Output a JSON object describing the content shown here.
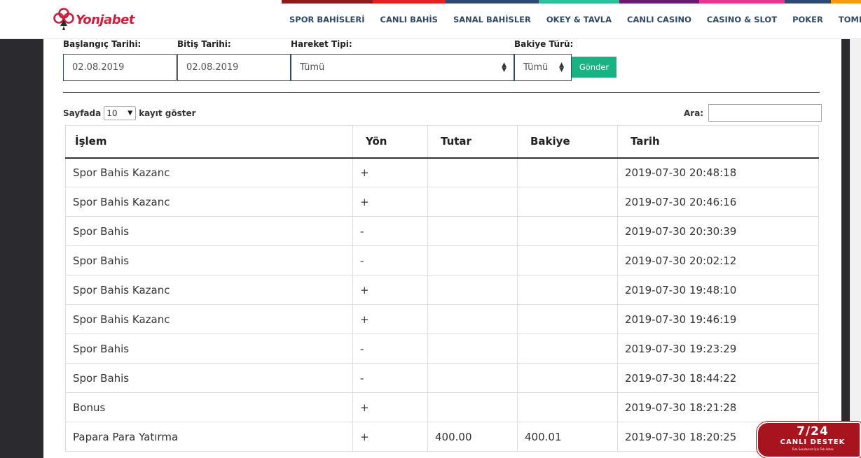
{
  "header": {
    "logo_text": "Yonjabet",
    "nav": [
      {
        "label": "SPOR BAHİSLERİ",
        "color": "#8b1c1c"
      },
      {
        "label": "CANLI BAHİS",
        "color": "#e31f1f"
      },
      {
        "label": "SANAL BAHİSLER",
        "color": "#2f4a6e"
      },
      {
        "label": "OKEY & TAVLA",
        "color": "#2fbf9b"
      },
      {
        "label": "CANLI CASINO",
        "color": "#6a1a73"
      },
      {
        "label": "CASINO & SLOT",
        "color": "#e8368f"
      },
      {
        "label": "POKER",
        "color": "#2f4a6e"
      },
      {
        "label": "TOMBALA",
        "color": "#f39c12"
      }
    ]
  },
  "filters": {
    "start_label": "Başlangıç Tarihi:",
    "start_value": "02.08.2019",
    "end_label": "Bitiş Tarihi:",
    "end_value": "02.08.2019",
    "type_label": "Hareket Tipi:",
    "type_value": "Tümü",
    "balance_label": "Bakiye Türü:",
    "balance_value": "Tümü",
    "submit_label": "Gönder"
  },
  "table_controls": {
    "length_prefix": "Sayfada",
    "length_value": "10",
    "length_suffix": "kayıt göster",
    "search_label": "Ara:"
  },
  "table": {
    "columns": [
      "İşlem",
      "Yön",
      "Tutar",
      "Bakiye",
      "Tarih"
    ],
    "rows": [
      [
        "Spor Bahis Kazanc",
        "+",
        "",
        "",
        "2019-07-30 20:48:18"
      ],
      [
        "Spor Bahis Kazanc",
        "+",
        "",
        "",
        "2019-07-30 20:46:16"
      ],
      [
        "Spor Bahis",
        "-",
        "",
        "",
        "2019-07-30 20:30:39"
      ],
      [
        "Spor Bahis",
        "-",
        "",
        "",
        "2019-07-30 20:02:12"
      ],
      [
        "Spor Bahis Kazanc",
        "+",
        "",
        "",
        "2019-07-30 19:48:10"
      ],
      [
        "Spor Bahis Kazanc",
        "+",
        "",
        "",
        "2019-07-30 19:46:19"
      ],
      [
        "Spor Bahis",
        "-",
        "",
        "",
        "2019-07-30 19:23:29"
      ],
      [
        "Spor Bahis",
        "-",
        "",
        "",
        "2019-07-30 18:44:22"
      ],
      [
        "Bonus",
        "+",
        "",
        "",
        "2019-07-30 18:21:28"
      ],
      [
        "Papara Para Yatırma",
        "+",
        "400.00",
        "400.01",
        "2019-07-30 18:20:25"
      ]
    ]
  },
  "live_support": {
    "hours": "7/24",
    "title": "CANLI DESTEK",
    "subtitle": "Tüm Sorularınız İçin Tek Adres"
  }
}
